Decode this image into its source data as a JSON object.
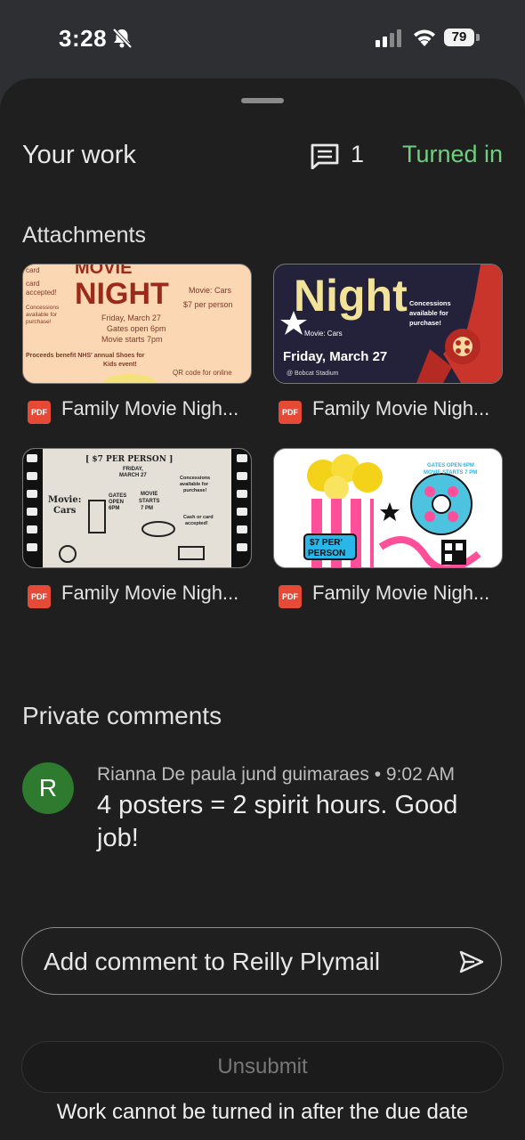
{
  "status_bar": {
    "time": "3:28",
    "battery": "79"
  },
  "header": {
    "title": "Your work",
    "comment_count": "1",
    "status": "Turned in",
    "status_color": "#6fcf7f"
  },
  "attachments": {
    "label": "Attachments",
    "items": [
      {
        "name": "Family Movie Nigh...",
        "type": "PDF",
        "poster_title": "NIGHT",
        "poster_top": "MOVIE",
        "poster_lines": [
          "Movie: Cars",
          "$7 per person",
          "Friday, March 27",
          "Gates open 6pm",
          "Movie starts 7pm"
        ],
        "poster_left": [
          "card",
          "accepted!",
          "Concessions",
          "available for",
          "purchase!"
        ],
        "poster_bottom": "Proceeds benefit NHS' annual Shoes for Kids event!",
        "poster_qr": "QR code for online"
      },
      {
        "name": "Family Movie Nigh...",
        "type": "PDF",
        "poster_title": "Night",
        "poster_lines": [
          "Concessions",
          "available for",
          "purchase!"
        ],
        "poster_sub": "Movie: Cars",
        "poster_date": "Friday, March 27",
        "poster_venue": "@ Bobcat Stadium"
      },
      {
        "name": "Family Movie Nigh...",
        "type": "PDF",
        "poster_price": "$7 PER PERSON",
        "poster_date": "FRIDAY, MARCH 27",
        "poster_movie": "Movie: Cars",
        "poster_gates": "GATES OPEN 6PM",
        "poster_starts": "MOVIE STARTS 7 PM",
        "poster_conc": "Concessions available for purchase!",
        "poster_cash": "Cash or card accepted!"
      },
      {
        "name": "Family Movie Nigh...",
        "type": "PDF",
        "poster_price": "$7 PER' PERSON",
        "poster_gates": "GATES OPEN 6PM",
        "poster_starts": "MOVIE STARTS 7 PM"
      }
    ]
  },
  "private_comments": {
    "label": "Private comments",
    "comments": [
      {
        "avatar_initial": "R",
        "author": "Rianna De paula jund guimaraes",
        "time": "9:02 AM",
        "text": "4 posters = 2 spirit hours. Good job!"
      }
    ],
    "input_placeholder": "Add comment to Reilly Plymail"
  },
  "footer": {
    "unsubmit_label": "Unsubmit",
    "note": "Work cannot be turned in after the due date"
  }
}
